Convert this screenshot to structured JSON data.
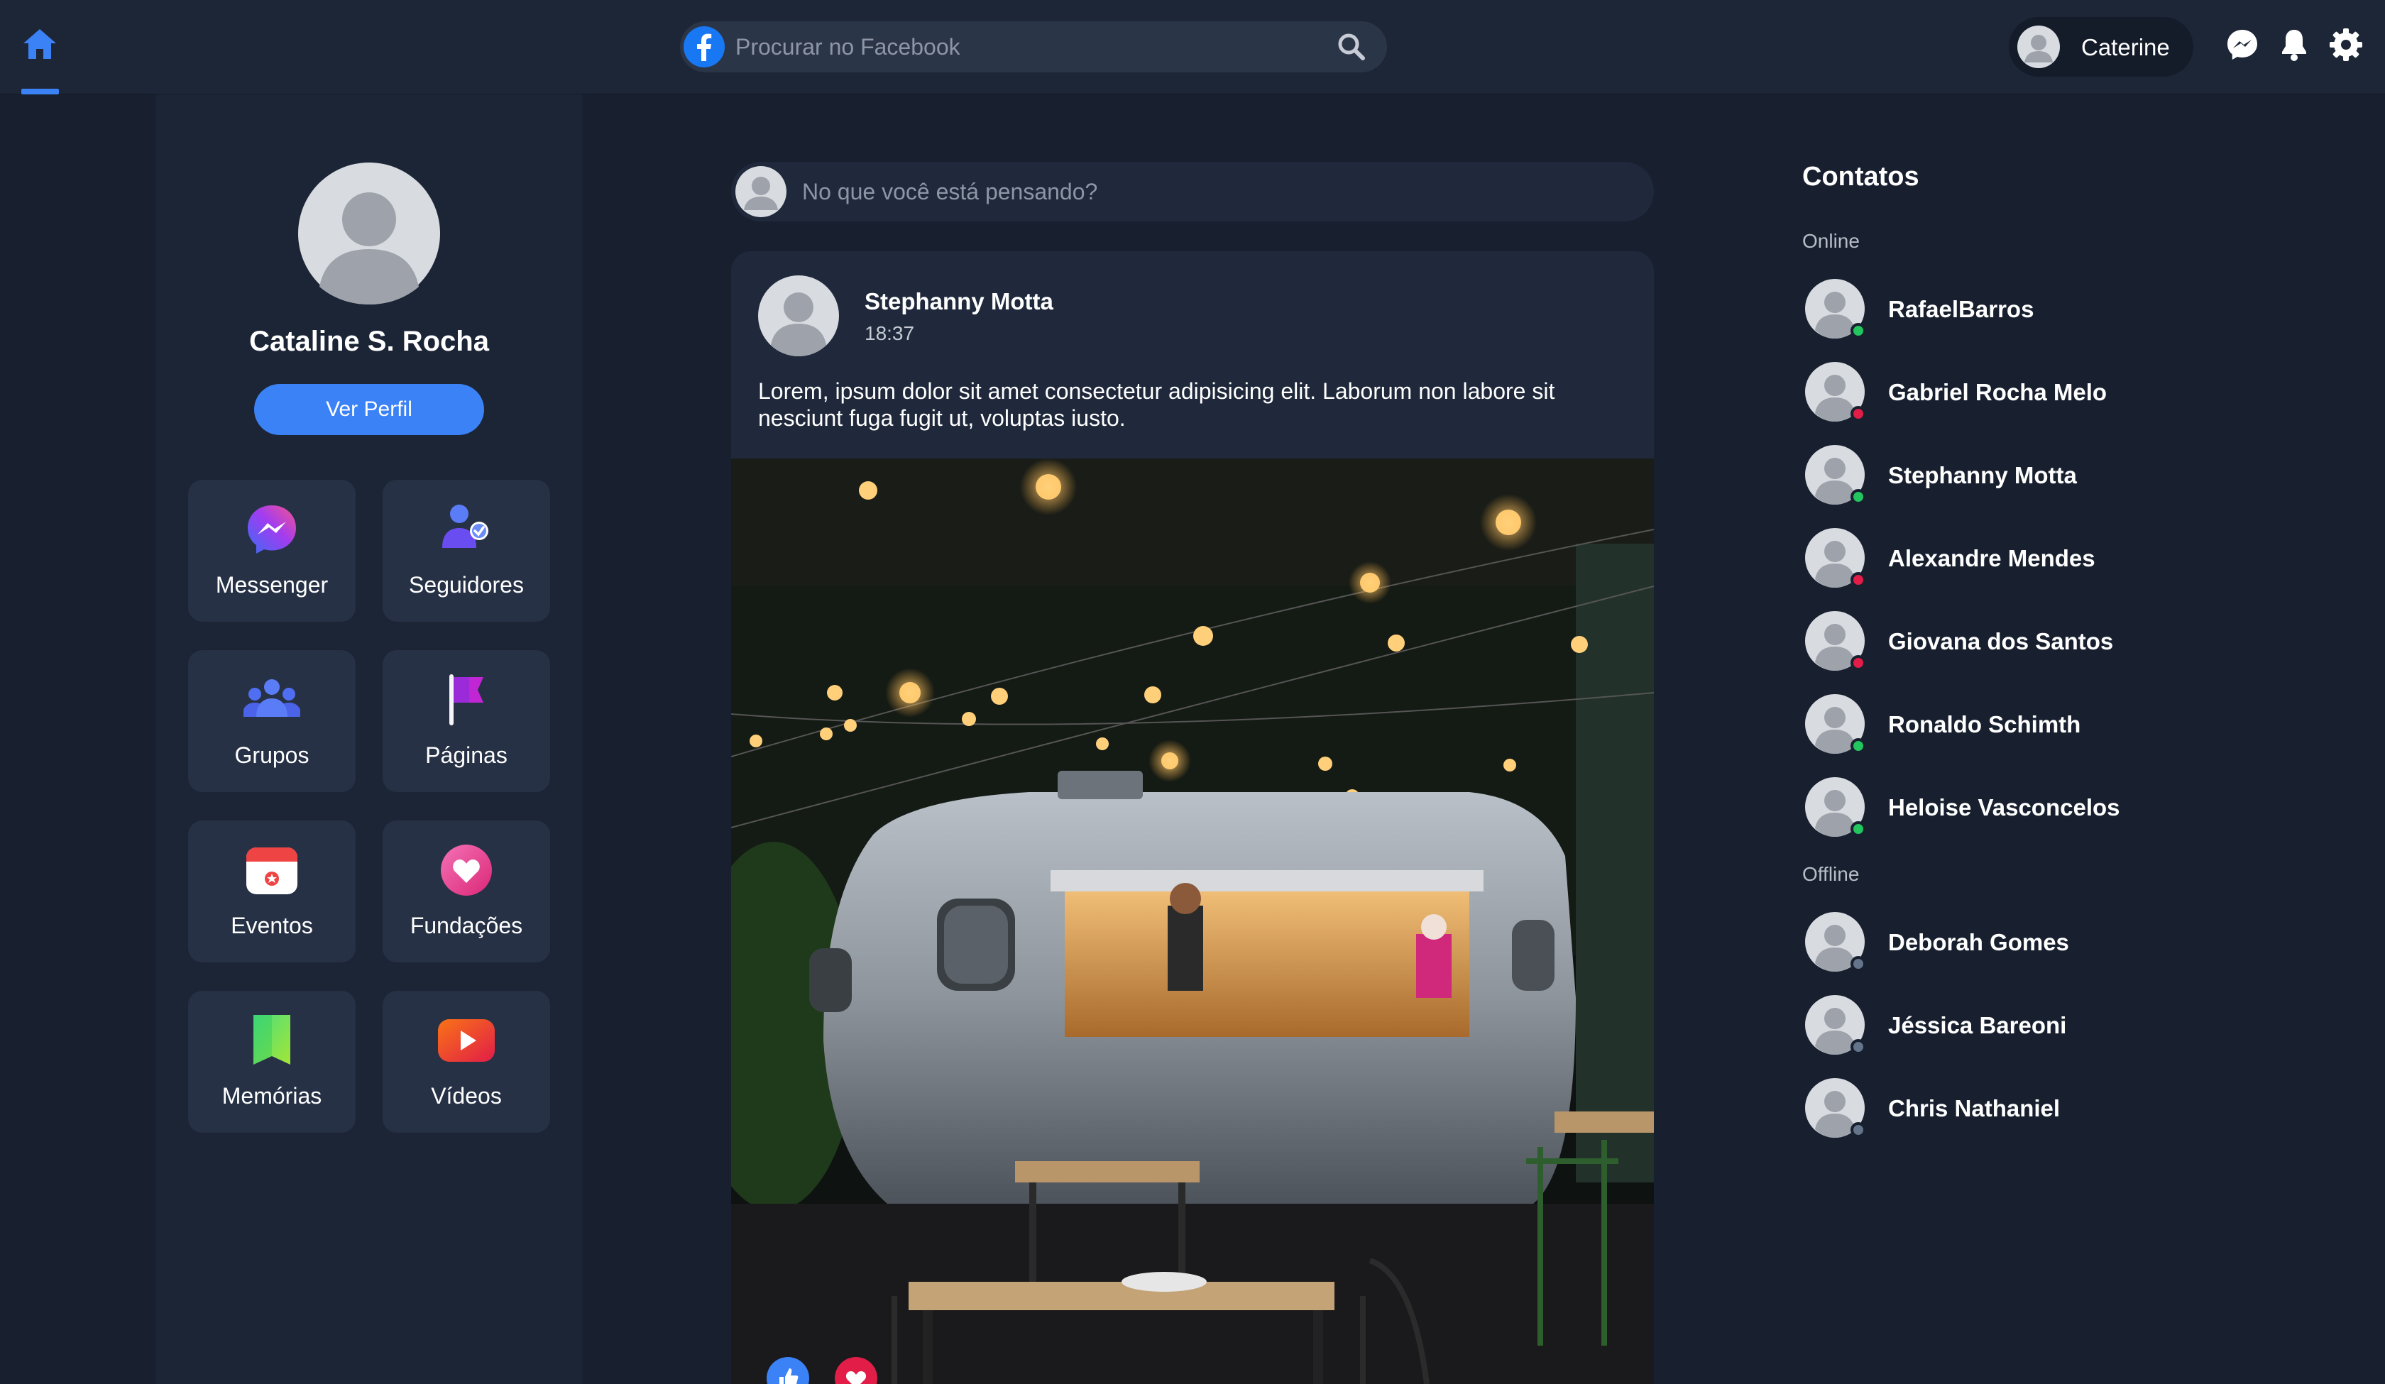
{
  "header": {
    "search_placeholder": "Procurar no Facebook",
    "user_name": "Caterine",
    "accent_color": "#3b82f6"
  },
  "sidebar": {
    "profile_name": "Cataline S. Rocha",
    "view_profile_label": "Ver Perfil",
    "tiles": [
      {
        "label": "Messenger",
        "icon": "messenger-icon"
      },
      {
        "label": "Seguidores",
        "icon": "followers-icon"
      },
      {
        "label": "Grupos",
        "icon": "groups-icon"
      },
      {
        "label": "Páginas",
        "icon": "pages-flag-icon"
      },
      {
        "label": "Eventos",
        "icon": "calendar-icon"
      },
      {
        "label": "Fundações",
        "icon": "heart-icon"
      },
      {
        "label": "Memórias",
        "icon": "bookmark-icon"
      },
      {
        "label": "Vídeos",
        "icon": "video-icon"
      }
    ]
  },
  "feed": {
    "composer_placeholder": "No que você está pensando?",
    "post": {
      "author": "Stephanny Motta",
      "time": "18:37",
      "text": "Lorem, ipsum dolor sit amet consectetur adipisicing elit. Laborum non labore sit nesciunt fuga fugit ut, voluptas iusto.",
      "image_icon": "food-truck-photo"
    }
  },
  "contacts": {
    "title": "Contatos",
    "online_label": "Online",
    "offline_label": "Offline",
    "online": [
      {
        "name": "RafaelBarros",
        "status": "online"
      },
      {
        "name": "Gabriel Rocha Melo",
        "status": "busy"
      },
      {
        "name": "Stephanny Motta",
        "status": "online"
      },
      {
        "name": "Alexandre Mendes",
        "status": "busy"
      },
      {
        "name": "Giovana dos Santos",
        "status": "busy"
      },
      {
        "name": "Ronaldo Schimth",
        "status": "online"
      },
      {
        "name": "Heloise Vasconcelos",
        "status": "online"
      }
    ],
    "offline": [
      {
        "name": "Deborah Gomes",
        "status": "offline"
      },
      {
        "name": "Jéssica Bareoni",
        "status": "offline"
      },
      {
        "name": "Chris Nathaniel",
        "status": "offline"
      }
    ],
    "status_colors": {
      "online": "#22c55e",
      "busy": "#e11d48",
      "offline": "#64748b"
    }
  }
}
